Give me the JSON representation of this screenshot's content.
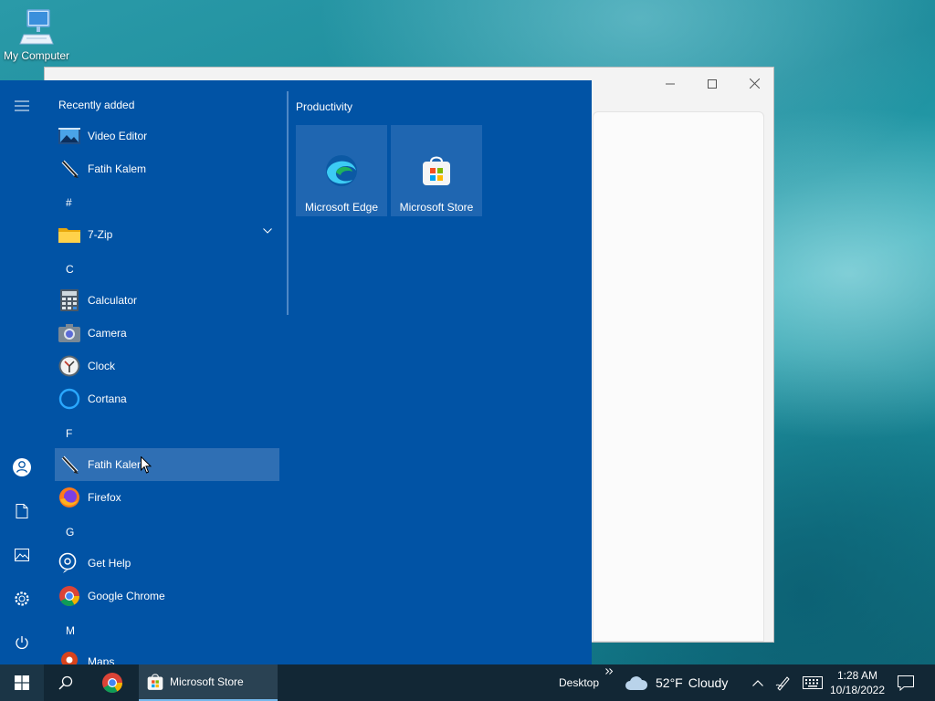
{
  "desktop": {
    "icons": [
      {
        "label": "My Computer",
        "icon": "computer-icon"
      }
    ]
  },
  "background_window": {
    "controls": [
      "minimize",
      "maximize",
      "close"
    ]
  },
  "start_menu": {
    "section_title": "Recently added",
    "recent": [
      {
        "label": "Video Editor",
        "icon": "video-editor-icon"
      },
      {
        "label": "Fatih Kalem",
        "icon": "pen-icon"
      }
    ],
    "letters": {
      "hash": "#",
      "c": "C",
      "f": "F",
      "g": "G",
      "m": "M"
    },
    "apps": {
      "zip": {
        "label": "7-Zip",
        "icon": "folder-icon"
      },
      "calculator": {
        "label": "Calculator",
        "icon": "calculator-icon"
      },
      "camera": {
        "label": "Camera",
        "icon": "camera-icon"
      },
      "clock": {
        "label": "Clock",
        "icon": "clock-icon"
      },
      "cortana": {
        "label": "Cortana",
        "icon": "cortana-icon"
      },
      "fatih": {
        "label": "Fatih Kalem",
        "icon": "pen-icon"
      },
      "firefox": {
        "label": "Firefox",
        "icon": "firefox-icon"
      },
      "gethelp": {
        "label": "Get Help",
        "icon": "help-icon"
      },
      "chrome": {
        "label": "Google Chrome",
        "icon": "chrome-icon"
      },
      "maps": {
        "label": "Maps",
        "icon": "maps-icon"
      }
    },
    "group": {
      "title": "Productivity",
      "tiles": [
        {
          "label": "Microsoft Edge",
          "icon": "edge-icon"
        },
        {
          "label": "Microsoft Store",
          "icon": "store-icon"
        }
      ]
    },
    "rail": [
      "menu-icon",
      "user-icon",
      "documents-icon",
      "pictures-icon",
      "settings-icon",
      "power-icon"
    ]
  },
  "taskbar": {
    "active_app": "Microsoft Store",
    "toolbar_label": "Desktop",
    "weather": {
      "temp": "52°F",
      "condition": "Cloudy"
    },
    "time": "1:28 AM",
    "date": "10/18/2022"
  },
  "colors": {
    "start_bg": "#0153a5",
    "tile_bg": "#1f66b1",
    "taskbar_bg": "#122735",
    "hover_bg": "#2f6fb4"
  }
}
